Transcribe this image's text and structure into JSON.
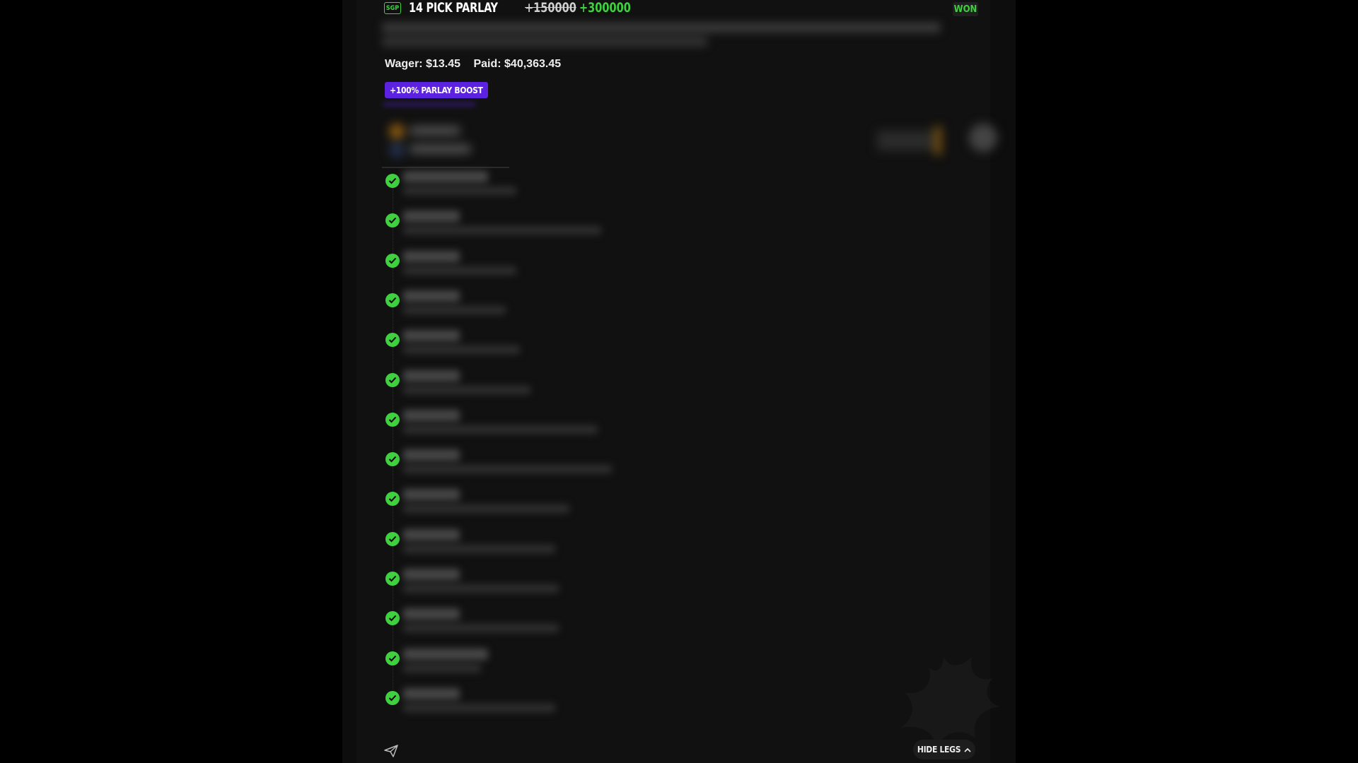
{
  "bet": {
    "type_badge": "SGP",
    "title": "14 PICK PARLAY",
    "odds_original": "+150000",
    "odds_boosted": "+300000",
    "status": "WON",
    "wager": "Wager: $13.45",
    "paid": "Paid: $40,363.45",
    "boost_label": "+100% PARLAY BOOST"
  },
  "legs": [
    {
      "status": "won"
    },
    {
      "status": "won"
    },
    {
      "status": "won"
    },
    {
      "status": "won"
    },
    {
      "status": "won"
    },
    {
      "status": "won"
    },
    {
      "status": "won"
    },
    {
      "status": "won"
    },
    {
      "status": "won"
    },
    {
      "status": "won"
    },
    {
      "status": "won"
    },
    {
      "status": "won"
    },
    {
      "status": "won"
    },
    {
      "status": "won"
    }
  ],
  "footer": {
    "hide_legs_label": "HIDE LEGS",
    "share_icon": "send-icon",
    "chevron_icon": "chevron-up-icon"
  },
  "colors": {
    "accent_green": "#3fd13f",
    "boost_purple": "#5b22e0",
    "background": "#111111"
  }
}
